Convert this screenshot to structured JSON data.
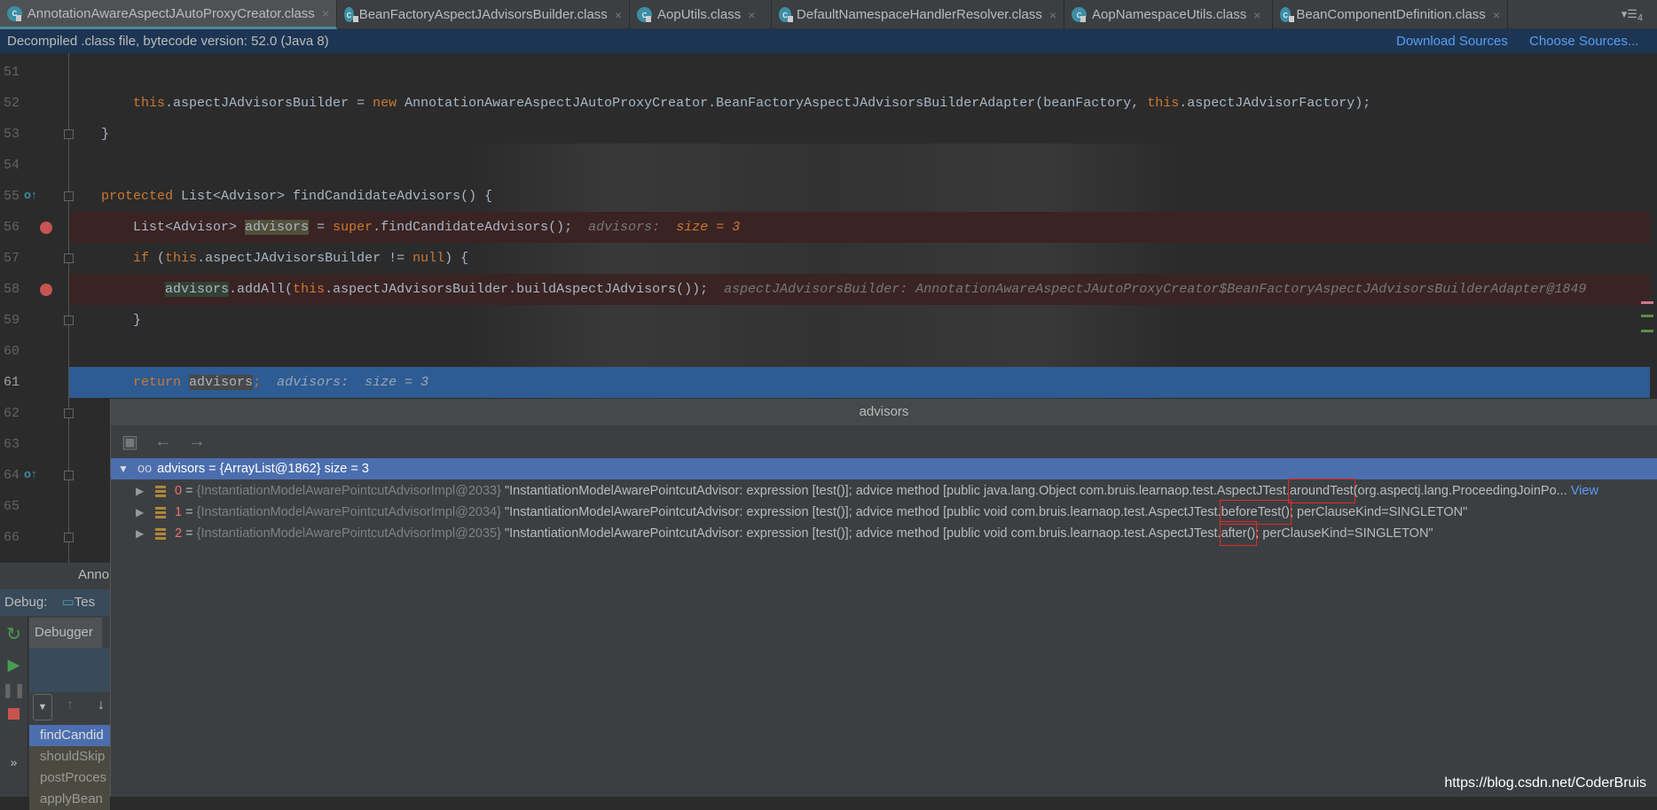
{
  "tabs": [
    {
      "label": "AnnotationAwareAspectJAutoProxyCreator.class",
      "active": true
    },
    {
      "label": "BeanFactoryAspectJAdvisorsBuilder.class"
    },
    {
      "label": "AopUtils.class"
    },
    {
      "label": "DefaultNamespaceHandlerResolver.class"
    },
    {
      "label": "AopNamespaceUtils.class"
    },
    {
      "label": "BeanComponentDefinition.class"
    }
  ],
  "tab_overflow": "4",
  "infobar": {
    "text": "Decompiled .class file, bytecode version: 52.0 (Java 8)",
    "download": "Download Sources",
    "choose": "Choose Sources..."
  },
  "code": {
    "line_numbers": [
      "51",
      "52",
      "53",
      "54",
      "55",
      "56",
      "57",
      "58",
      "59",
      "60",
      "61",
      "62",
      "63",
      "64",
      "65",
      "66"
    ],
    "l52a": "this",
    "l52b": ".aspectJAdvisorsBuilder = ",
    "l52c": "new",
    "l52d": " AnnotationAwareAspectJAutoProxyCreator.BeanFactoryAspectJAdvisorsBuilderAdapter(beanFactory, ",
    "l52e": "this",
    "l52f": ".aspectJAdvisorFactory);",
    "l53": "}",
    "l55a": "protected",
    "l55b": " List<Advisor> findCandidateAdvisors() {",
    "l56a": "List<Advisor> ",
    "l56b": "advisors",
    "l56c": " = ",
    "l56d": "super",
    "l56e": ".findCandidateAdvisors();",
    "l56f": "advisors:",
    "l56g": "size = 3",
    "l57a": "if",
    "l57b": " (",
    "l57c": "this",
    "l57d": ".aspectJAdvisorsBuilder != ",
    "l57e": "null",
    "l57f": ") {",
    "l58a": "advisors",
    "l58b": ".addAll(",
    "l58c": "this",
    "l58d": ".aspectJAdvisorsBuilder.buildAspectJAdvisors());",
    "l58e": "aspectJAdvisorsBuilder: AnnotationAwareAspectJAutoProxyCreator$BeanFactoryAspectJAdvisorsBuilderAdapter@1849",
    "l59": "}",
    "l61a": "return",
    "l61b": "advisors",
    "l61c": ";",
    "l61d": "advisors:  size = 3"
  },
  "popup": {
    "title": "advisors",
    "root": {
      "name": "advisors",
      "value": "= {ArrayList@1862}  size = 3"
    },
    "items": [
      {
        "index": "0",
        "ref": "{InstantiationModelAwarePointcutAdvisorImpl@2033}",
        "pre": "\"InstantiationModelAwarePointcutAdvisor: expression [test()]; advice method [public java.lang.Object com.bruis.learnaop.test.AspectJTest.",
        "method": "aroundTest",
        "post": "(org.aspectj.lang.ProceedingJoinPo...",
        "view": "View"
      },
      {
        "index": "1",
        "ref": "{InstantiationModelAwarePointcutAdvisorImpl@2034}",
        "pre": "\"InstantiationModelAwarePointcutAdvisor: expression [test()]; advice method [public void com.bruis.learnaop.test.AspectJTest.",
        "method": "beforeTest()",
        "post": "; perClauseKind=SINGLETON\""
      },
      {
        "index": "2",
        "ref": "{InstantiationModelAwarePointcutAdvisorImpl@2035}",
        "pre": "\"InstantiationModelAwarePointcutAdvisor: expression [test()]; advice method [public void com.bruis.learnaop.test.AspectJTest.",
        "method": "after()",
        "post": "; perClauseKind=SINGLETON\""
      }
    ]
  },
  "debug": {
    "editor_tab": "Anno",
    "label": "Debug:",
    "config": "Tes",
    "debugger_tab": "Debugger",
    "frames": [
      "findCandid",
      "shouldSkip",
      "postProces",
      "applyBean"
    ],
    "more": "»"
  },
  "watermark": "https://blog.csdn.net/CoderBruis"
}
